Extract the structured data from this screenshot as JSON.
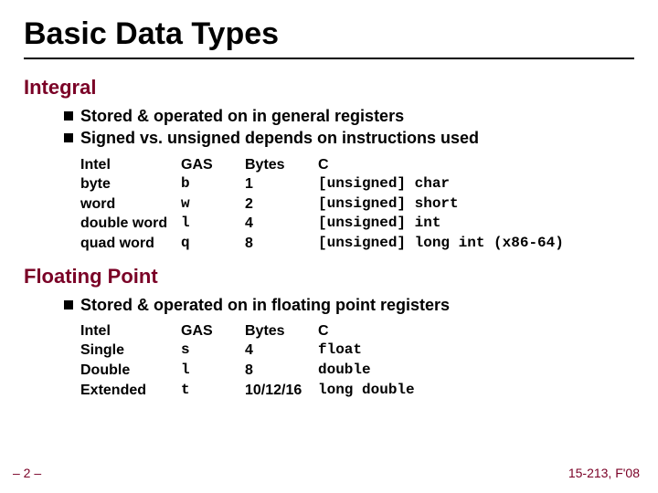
{
  "title": "Basic Data Types",
  "integral": {
    "heading": "Integral",
    "bullets": [
      "Stored & operated on in general registers",
      "Signed vs. unsigned depends on instructions used"
    ],
    "header": {
      "intel": "Intel",
      "gas": "GAS",
      "bytes": "Bytes",
      "c": "C"
    },
    "rows": [
      {
        "intel": "byte",
        "gas": "b",
        "bytes": "1",
        "c": "[unsigned] char"
      },
      {
        "intel": "word",
        "gas": "w",
        "bytes": "2",
        "c": "[unsigned] short"
      },
      {
        "intel": "double word",
        "gas": "l",
        "bytes": "4",
        "c": "[unsigned] int"
      },
      {
        "intel": "quad word",
        "gas": "q",
        "bytes": "8",
        "c": "[unsigned] long int (x86-64)"
      }
    ]
  },
  "fp": {
    "heading": "Floating Point",
    "bullets": [
      "Stored & operated on in floating point registers"
    ],
    "header": {
      "intel": "Intel",
      "gas": "GAS",
      "bytes": "Bytes",
      "c": "C"
    },
    "rows": [
      {
        "intel": "Single",
        "gas": "s",
        "bytes": "4",
        "c": "float"
      },
      {
        "intel": "Double",
        "gas": "l",
        "bytes": "8",
        "c": "double"
      },
      {
        "intel": "Extended",
        "gas": "t",
        "bytes": "10/12/16",
        "c": "long double"
      }
    ]
  },
  "page": "– 2 –",
  "footer": "15-213, F'08"
}
